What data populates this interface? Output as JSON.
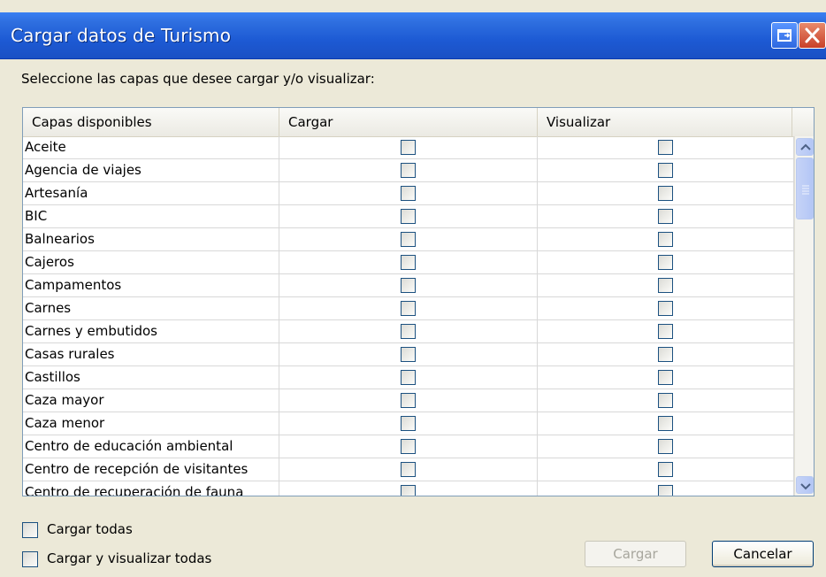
{
  "window": {
    "title": "Cargar datos de Turismo"
  },
  "prompt": "Seleccione las capas que desee cargar y/o visualizar:",
  "table": {
    "columns": [
      "Capas disponibles",
      "Cargar",
      "Visualizar"
    ],
    "rows": [
      "Aceite",
      "Agencia de viajes",
      "Artesanía",
      "BIC",
      "Balnearios",
      "Cajeros",
      "Campamentos",
      "Carnes",
      "Carnes y embutidos",
      "Casas rurales",
      "Castillos",
      "Caza mayor",
      "Caza menor",
      "Centro de educación ambiental",
      "Centro de recepción de visitantes",
      "Centro de recuperación de fauna"
    ]
  },
  "options": {
    "load_all": "Cargar todas",
    "load_view_all": "Cargar y visualizar todas"
  },
  "buttons": {
    "load": "Cargar",
    "cancel": "Cancelar"
  },
  "icons": {
    "restore": "restore-icon",
    "close": "close-icon",
    "scroll_up": "arrow-up-icon",
    "scroll_down": "arrow-down-icon"
  },
  "colors": {
    "titlebar": "#1d5ad4",
    "close": "#c8402a",
    "scrollbar": "#b3c6f5"
  }
}
